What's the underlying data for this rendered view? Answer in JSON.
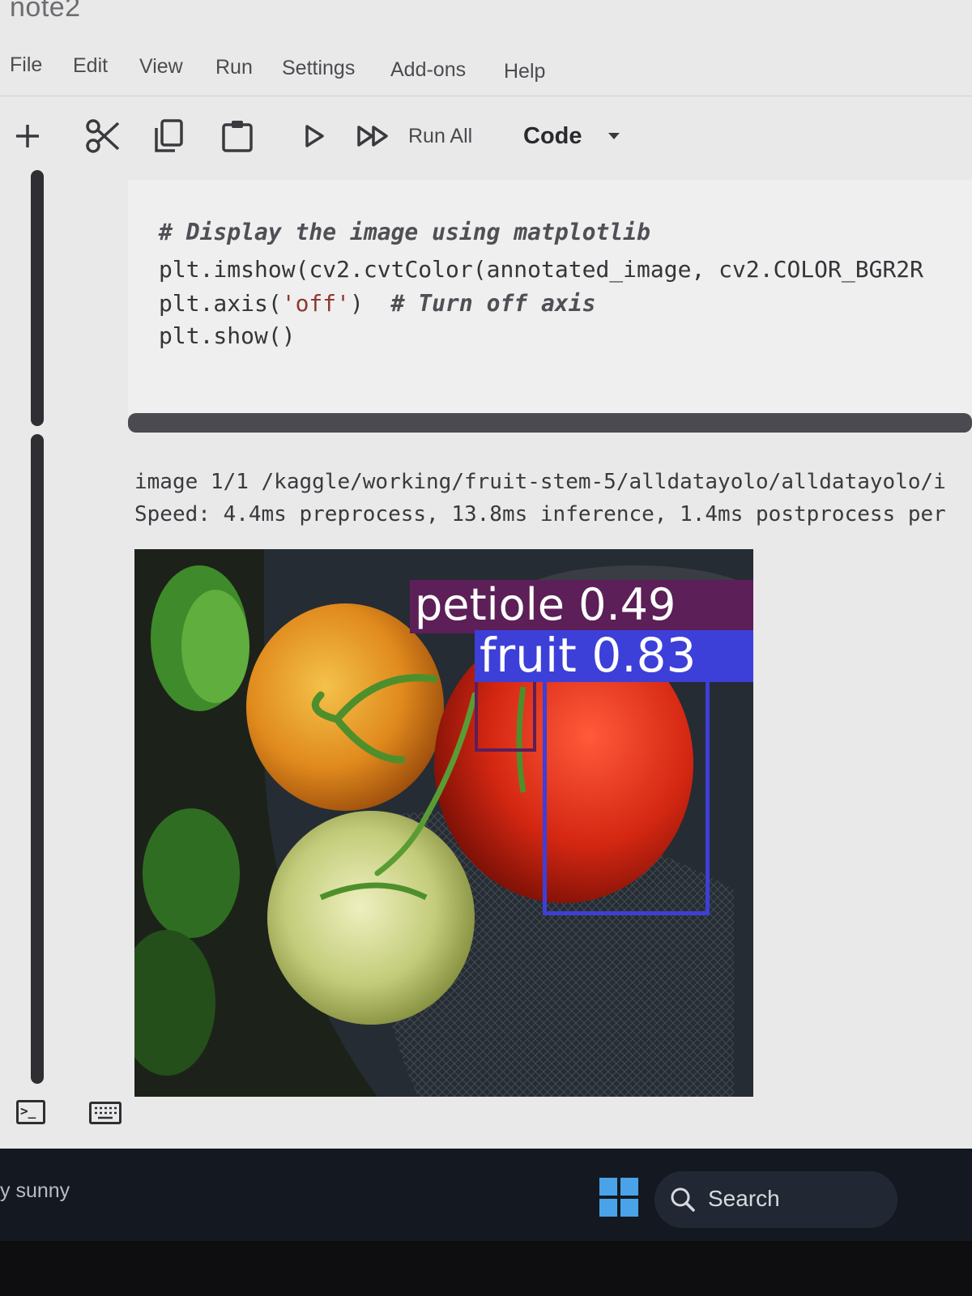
{
  "notebook": {
    "title": "note2"
  },
  "menubar": {
    "items": [
      "File",
      "Edit",
      "View",
      "Run",
      "Settings",
      "Add-ons",
      "Help"
    ]
  },
  "toolbar": {
    "add_icon": "plus-icon",
    "cut_icon": "scissors-icon",
    "copy_icon": "copy-icon",
    "paste_icon": "clipboard-icon",
    "run_icon": "play-icon",
    "run_all_icon": "fast-forward-icon",
    "run_all_label": "Run All",
    "cell_type_value": "Code"
  },
  "code_cell": {
    "line1": "# Display the image using matplotlib",
    "line2_a": "plt.imshow(",
    "line2_b": "cv2.cvtColor(annotated_image, cv2.COLOR_BGR2R",
    "line3_a": "plt.axis(",
    "line3_str": "'off'",
    "line3_b": ")  ",
    "line3_cmt": "# Turn off axis",
    "line4": "plt.show()"
  },
  "output": {
    "line1": "image 1/1 /kaggle/working/fruit-stem-5/alldatayolo/alldatayolo/i",
    "line2": "Speed: 4.4ms preprocess, 13.8ms inference, 1.4ms postprocess per",
    "detections": [
      {
        "label": "petiole 0.49",
        "class": "petiole",
        "confidence": 0.49,
        "color": "#5c1f57"
      },
      {
        "label": "fruit 0.83",
        "class": "fruit",
        "confidence": 0.83,
        "color": "#3d3fd9"
      }
    ]
  },
  "taskbar": {
    "weather_text": "y sunny",
    "start_icon": "windows-logo-icon",
    "search_label": "Search"
  }
}
